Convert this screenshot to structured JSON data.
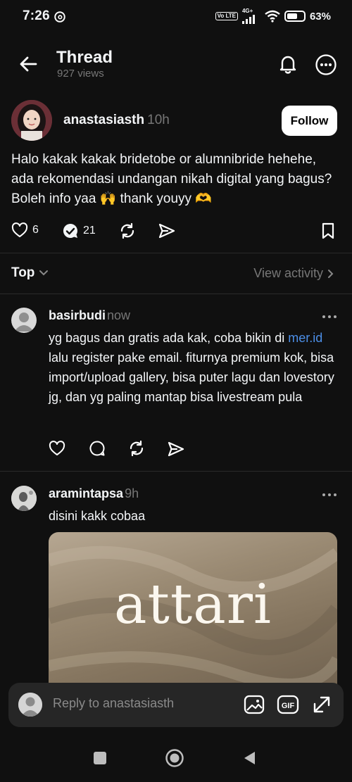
{
  "status_bar": {
    "time": "7:26",
    "network": "4G+",
    "volte": "Vo LTE",
    "battery": "63%",
    "battery_level": 0.63
  },
  "header": {
    "title": "Thread",
    "views": "927 views"
  },
  "post": {
    "author": "anastasiasth",
    "time": "10h",
    "follow_label": "Follow",
    "text": "Halo kakak kakak bridetobe or alumnibride hehehe, ada rekomendasi undangan nikah digital yang bagus? Boleh info yaa 🙌 thank youyy 🫶",
    "likes": "6",
    "replies": "21"
  },
  "sort": {
    "label": "Top",
    "view_activity": "View activity"
  },
  "comments": [
    {
      "author": "basirbudi",
      "time": "now",
      "text_before": "yg bagus dan gratis ada kak,  coba bikin di ",
      "link": "mer.id",
      "text_after": " lalu register pake email. fiturnya premium kok, bisa import/upload gallery, bisa puter lagu dan lovestory jg, dan yg paling mantap bisa livestream pula"
    },
    {
      "author": "aramintapsa",
      "time": "9h",
      "text": "disini kakk cobaa",
      "media_word": "attari"
    }
  ],
  "reply_bar": {
    "placeholder": "Reply to anastasiasth"
  },
  "colors": {
    "background": "#101010",
    "link": "#4c8fe8",
    "muted": "#777777",
    "reply_bar": "#262626"
  }
}
